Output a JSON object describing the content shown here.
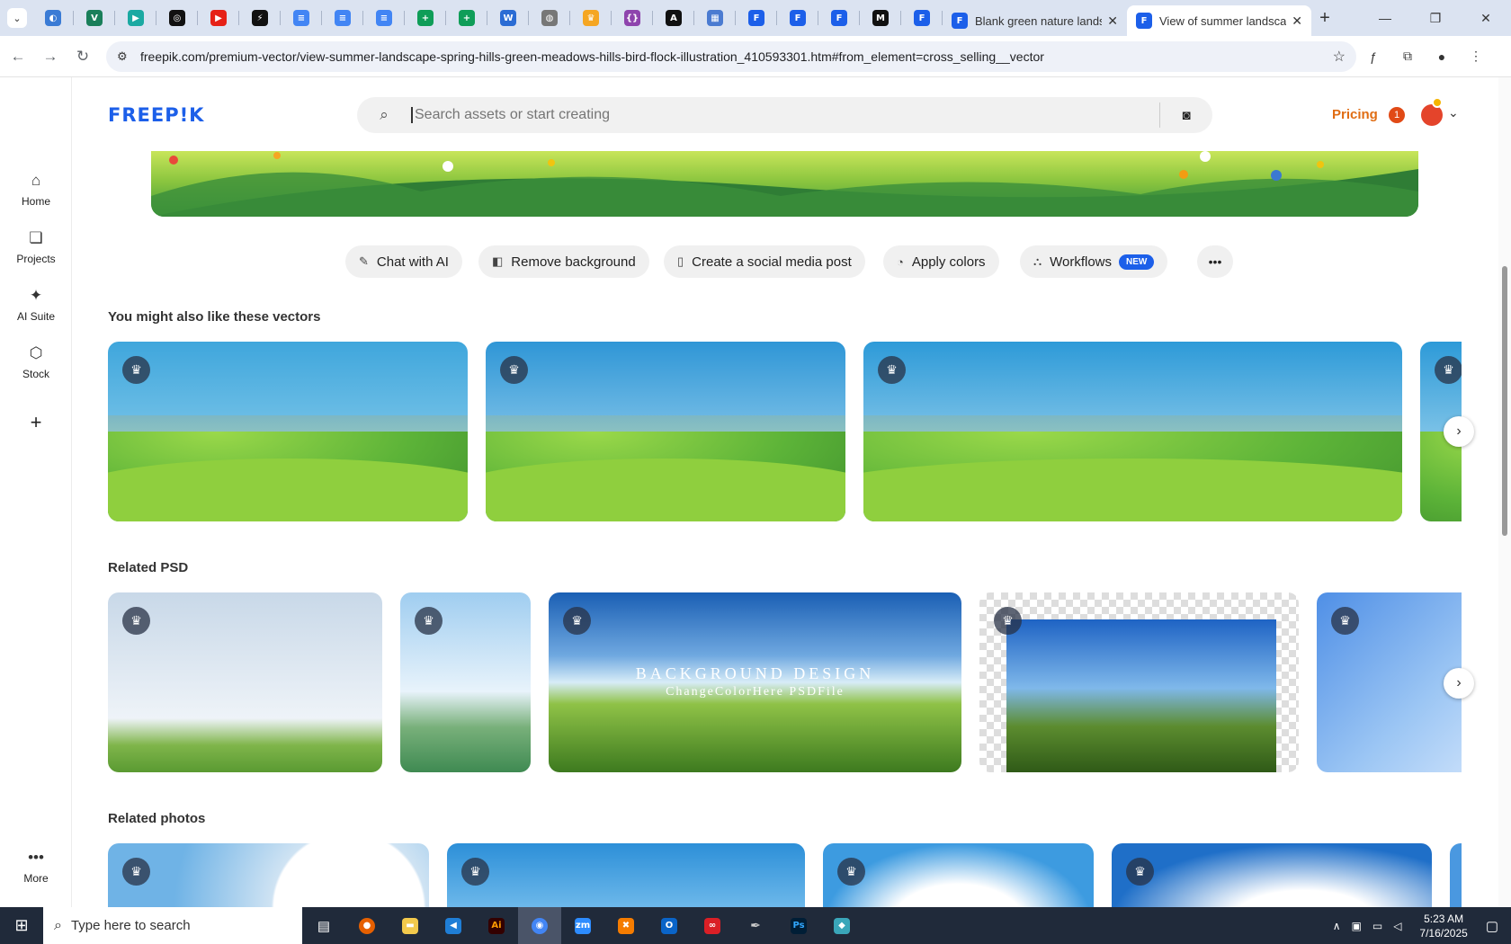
{
  "browser": {
    "pinned_tabs": [
      {
        "icon": "globe-blue-icon",
        "color": "#3a7bd5",
        "glyph": "◐"
      },
      {
        "icon": "v-shield-icon",
        "color": "#1a7f5a",
        "glyph": "V"
      },
      {
        "icon": "play-teal-icon",
        "color": "#1ba9a2",
        "glyph": "▶"
      },
      {
        "icon": "openai-icon",
        "color": "#111111",
        "glyph": "◎"
      },
      {
        "icon": "youtube-icon",
        "color": "#e62117",
        "glyph": "▶"
      },
      {
        "icon": "bolt-icon",
        "color": "#111111",
        "glyph": "⚡"
      },
      {
        "icon": "docs-icon",
        "color": "#4285f4",
        "glyph": "≡"
      },
      {
        "icon": "docs-icon",
        "color": "#4285f4",
        "glyph": "≡"
      },
      {
        "icon": "docs-icon",
        "color": "#4285f4",
        "glyph": "≡"
      },
      {
        "icon": "sheets-icon",
        "color": "#0f9d58",
        "glyph": "+"
      },
      {
        "icon": "sheets-icon",
        "color": "#0f9d58",
        "glyph": "+"
      },
      {
        "icon": "word-icon",
        "color": "#2b6cd4",
        "glyph": "W"
      },
      {
        "icon": "globe-grey-icon",
        "color": "#777777",
        "glyph": "◍"
      },
      {
        "icon": "crown-icon",
        "color": "#f5a623",
        "glyph": "♛"
      },
      {
        "icon": "braces-icon",
        "color": "#8e44ad",
        "glyph": "{}"
      },
      {
        "icon": "a-icon",
        "color": "#111111",
        "glyph": "A"
      },
      {
        "icon": "grid-icon",
        "color": "#4b7bd1",
        "glyph": "▦"
      },
      {
        "icon": "freepik-tab-icon",
        "color": "#1c5fe9",
        "glyph": "F"
      },
      {
        "icon": "freepik-tab-icon",
        "color": "#1c5fe9",
        "glyph": "F"
      },
      {
        "icon": "freepik-tab-icon",
        "color": "#1c5fe9",
        "glyph": "F"
      },
      {
        "icon": "m-icon",
        "color": "#111111",
        "glyph": "M"
      },
      {
        "icon": "freepik-tab-icon",
        "color": "#1c5fe9",
        "glyph": "F"
      }
    ],
    "tabs": [
      {
        "title": "Blank green nature landscape",
        "active": false
      },
      {
        "title": "View of summer landscape",
        "active": true
      }
    ],
    "url": "freepik.com/premium-vector/view-summer-landscape-spring-hills-green-meadows-hills-bird-flock-illustration_410593301.htm#from_element=cross_selling__vector"
  },
  "sidebar": {
    "items": [
      {
        "label": "Home",
        "icon": "home-icon"
      },
      {
        "label": "Projects",
        "icon": "projects-icon"
      },
      {
        "label": "AI Suite",
        "icon": "sparkle-icon"
      },
      {
        "label": "Stock",
        "icon": "stock-icon"
      }
    ],
    "more_label": "More"
  },
  "header": {
    "logo": "FREEP!K",
    "search_placeholder": "Search assets or start creating",
    "pricing": "Pricing",
    "notification_count": "1"
  },
  "actions": {
    "chat": "Chat with AI",
    "remove_bg": "Remove background",
    "social": "Create a social media post",
    "colors": "Apply colors",
    "workflows": "Workflows",
    "new_badge": "NEW"
  },
  "sections": {
    "vectors_title": "You might also like these vectors",
    "psd_title": "Related PSD",
    "photos_title": "Related photos"
  },
  "psd_overlay": {
    "title": "BACKGROUND DESIGN",
    "subtitle": "ChangeColorHere PSDFile"
  },
  "taskbar": {
    "search_placeholder": "Type here to search",
    "time": "5:23 AM",
    "date": "7/16/2025"
  }
}
